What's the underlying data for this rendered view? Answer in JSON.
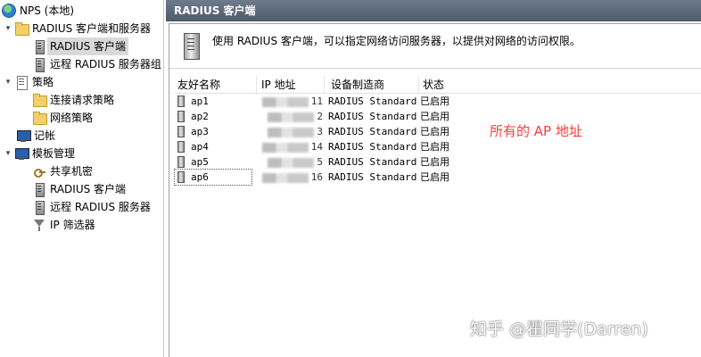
{
  "tree": {
    "items": [
      {
        "label": "NPS (本地)",
        "icon": "globe-icon"
      },
      {
        "label": "RADIUS 客户端和服务器",
        "icon": "folder-icon"
      },
      {
        "label": "RADIUS 客户端",
        "icon": "server-icon",
        "selected": true
      },
      {
        "label": "远程 RADIUS 服务器组",
        "icon": "server-icon"
      },
      {
        "label": "策略",
        "icon": "doc-icon"
      },
      {
        "label": "连接请求策略",
        "icon": "folder-icon"
      },
      {
        "label": "网络策略",
        "icon": "folder-icon"
      },
      {
        "label": "记帐",
        "icon": "monitor-icon"
      },
      {
        "label": "模板管理",
        "icon": "monitor-icon"
      },
      {
        "label": "共享机密",
        "icon": "key-icon"
      },
      {
        "label": "RADIUS 客户端",
        "icon": "server-icon"
      },
      {
        "label": "远程 RADIUS 服务器",
        "icon": "server-icon"
      },
      {
        "label": "IP 筛选器",
        "icon": "filter-icon"
      }
    ]
  },
  "pane": {
    "title": "RADIUS 客户端",
    "info_text": "使用 RADIUS 客户端，可以指定网络访问服务器，以提供对网络的访问权限。",
    "columns": [
      "友好名称",
      "IP 地址",
      "设备制造商",
      "状态"
    ],
    "rows": [
      {
        "name": "ap1",
        "ip_tail": "11",
        "vendor": "RADIUS Standard",
        "status": "已启用"
      },
      {
        "name": "ap2",
        "ip_tail": "2",
        "vendor": "RADIUS Standard",
        "status": "已启用"
      },
      {
        "name": "ap3",
        "ip_tail": "3",
        "vendor": "RADIUS Standard",
        "status": "已启用"
      },
      {
        "name": "ap4",
        "ip_tail": "14",
        "vendor": "RADIUS Standard",
        "status": "已启用"
      },
      {
        "name": "ap5",
        "ip_tail": "5",
        "vendor": "RADIUS Standard",
        "status": "已启用"
      },
      {
        "name": "ap6",
        "ip_tail": "16",
        "vendor": "RADIUS Standard",
        "status": "已启用"
      }
    ]
  },
  "annotation": "所有的 AP 地址",
  "watermark": "知乎 @瞿同学(Darren)"
}
